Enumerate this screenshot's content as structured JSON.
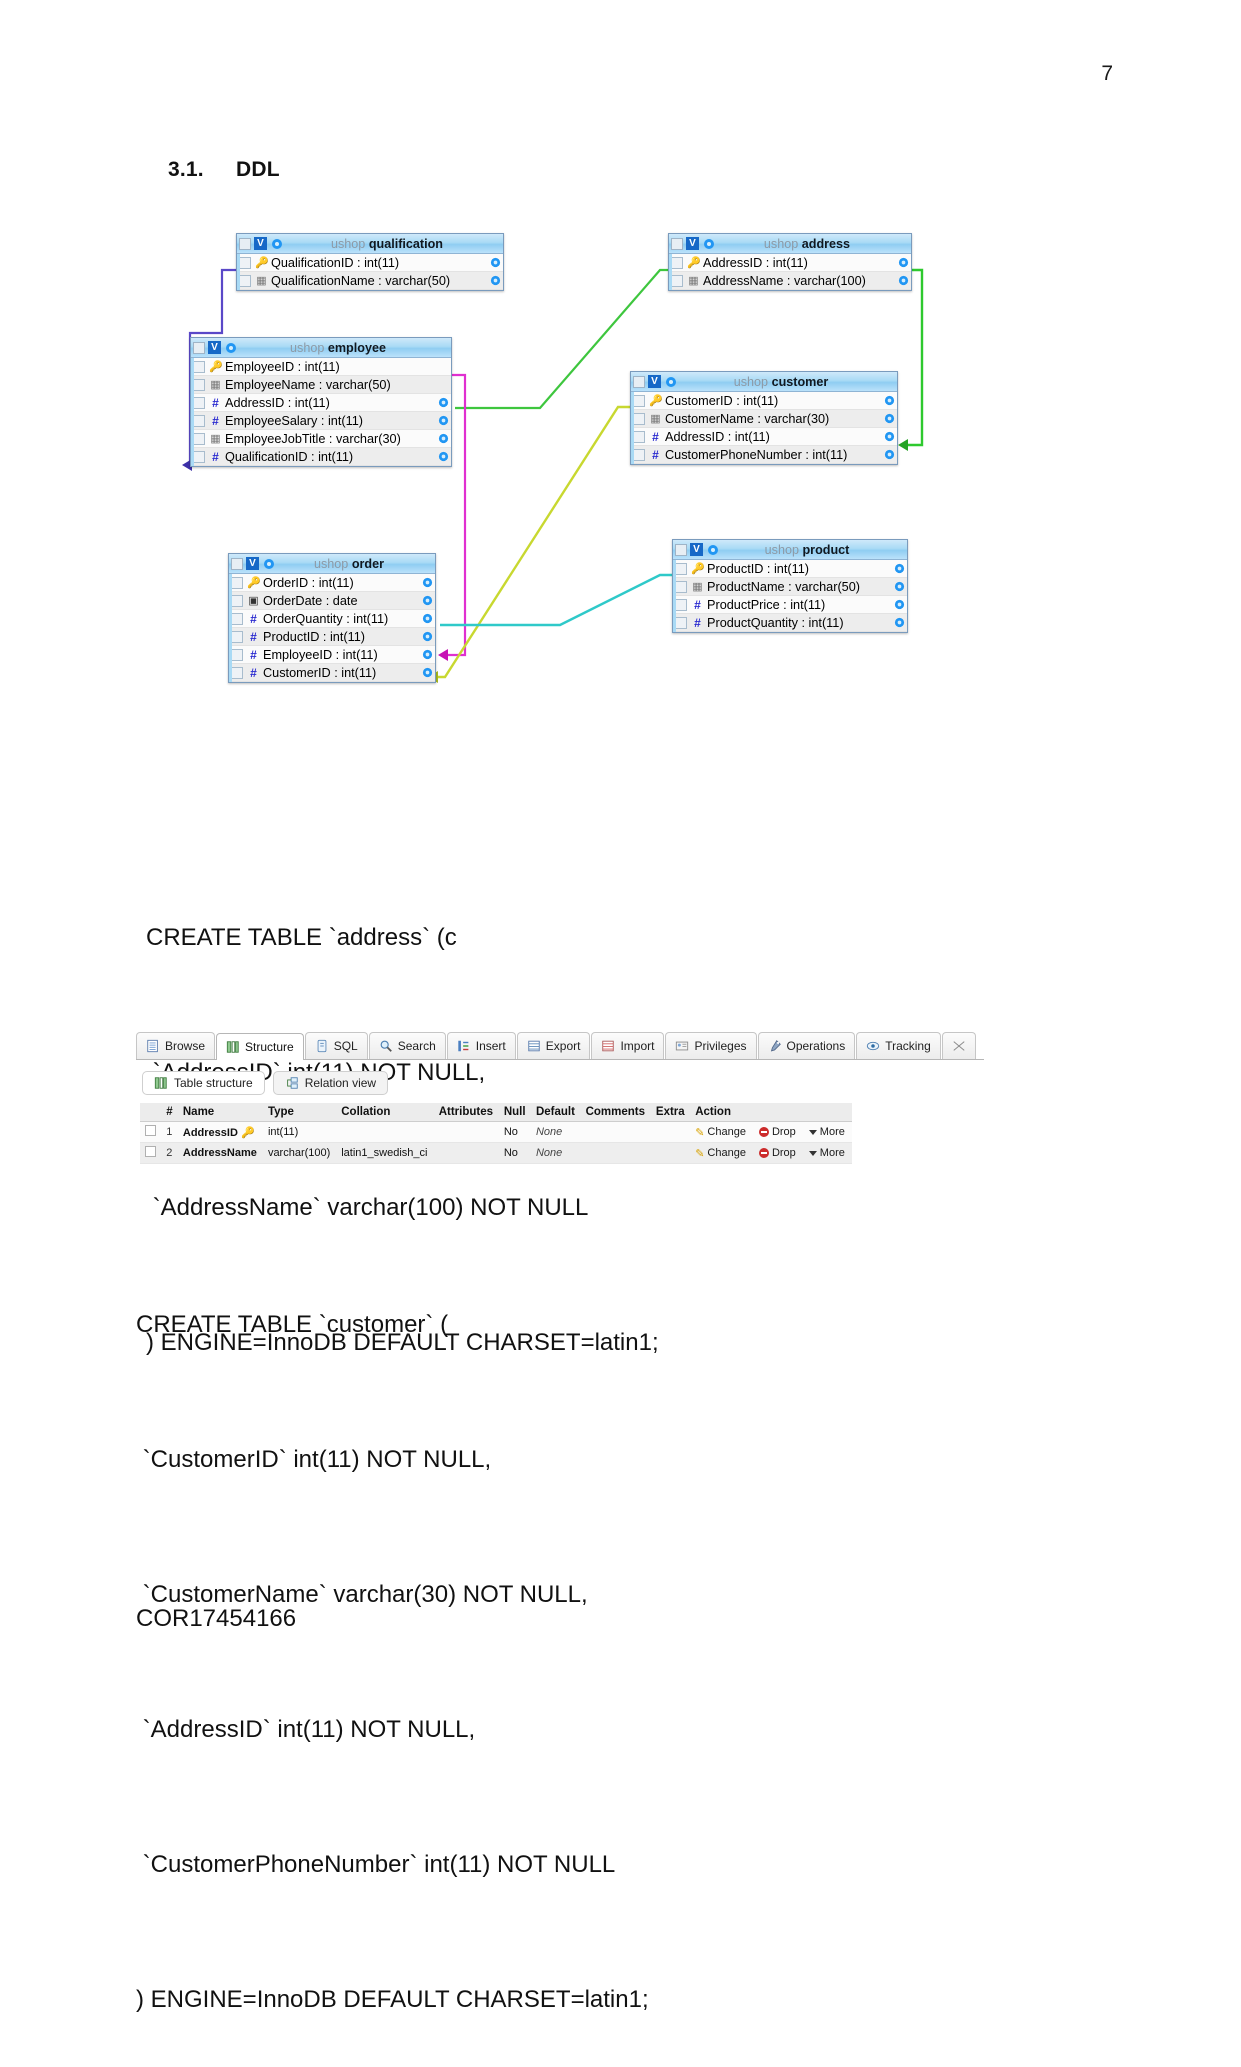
{
  "page": {
    "number": "7",
    "footer_id": "COR17454166"
  },
  "heading": {
    "number": "3.1.",
    "text": "DDL"
  },
  "designer": {
    "database": "ushop",
    "tables": [
      {
        "id": "qualification",
        "name": "qualification",
        "db": "ushop",
        "columns": [
          {
            "icon": "primary-key",
            "label": "QualificationID : int(11)"
          },
          {
            "icon": "text",
            "label": "QualificationName : varchar(50)"
          }
        ]
      },
      {
        "id": "address",
        "name": "address",
        "db": "ushop",
        "columns": [
          {
            "icon": "primary-key",
            "label": "AddressID : int(11)"
          },
          {
            "icon": "text",
            "label": "AddressName : varchar(100)"
          }
        ]
      },
      {
        "id": "employee",
        "name": "employee",
        "db": "ushop",
        "columns": [
          {
            "icon": "primary-key",
            "label": "EmployeeID : int(11)"
          },
          {
            "icon": "text",
            "label": "EmployeeName : varchar(50)"
          },
          {
            "icon": "number",
            "label": "AddressID : int(11)"
          },
          {
            "icon": "number",
            "label": "EmployeeSalary : int(11)"
          },
          {
            "icon": "text",
            "label": "EmployeeJobTitle : varchar(30)"
          },
          {
            "icon": "number",
            "label": "QualificationID : int(11)"
          }
        ]
      },
      {
        "id": "customer",
        "name": "customer",
        "db": "ushop",
        "columns": [
          {
            "icon": "primary-key",
            "label": "CustomerID : int(11)"
          },
          {
            "icon": "text",
            "label": "CustomerName : varchar(30)"
          },
          {
            "icon": "number",
            "label": "AddressID : int(11)"
          },
          {
            "icon": "number",
            "label": "CustomerPhoneNumber : int(11)"
          }
        ]
      },
      {
        "id": "order",
        "name": "order",
        "db": "ushop",
        "columns": [
          {
            "icon": "primary-key",
            "label": "OrderID : int(11)"
          },
          {
            "icon": "date",
            "label": "OrderDate : date"
          },
          {
            "icon": "number",
            "label": "OrderQuantity : int(11)"
          },
          {
            "icon": "number",
            "label": "ProductID : int(11)"
          },
          {
            "icon": "number",
            "label": "EmployeeID : int(11)"
          },
          {
            "icon": "number",
            "label": "CustomerID : int(11)"
          }
        ]
      },
      {
        "id": "product",
        "name": "product",
        "db": "ushop",
        "columns": [
          {
            "icon": "primary-key",
            "label": "ProductID : int(11)"
          },
          {
            "icon": "text",
            "label": "ProductName : varchar(50)"
          },
          {
            "icon": "number",
            "label": "ProductPrice : int(11)"
          },
          {
            "icon": "number",
            "label": "ProductQuantity : int(11)"
          }
        ]
      }
    ],
    "relation_colors": {
      "qualification_employee": "#5a48c8",
      "employee_address": "#2fbf2f",
      "customer_address": "#1fc31f",
      "employee_order": "#e02fd0",
      "customer_order": "#c8d830",
      "product_order": "#2fc9c9"
    }
  },
  "code_blocks": [
    {
      "id": "create-address",
      "lines": [
        "CREATE TABLE `address` (c",
        " `AddressID` int(11) NOT NULL,",
        " `AddressName` varchar(100) NOT NULL",
        ") ENGINE=InnoDB DEFAULT CHARSET=latin1;"
      ]
    },
    {
      "id": "create-customer",
      "lines": [
        "CREATE TABLE `customer` (",
        " `CustomerID` int(11) NOT NULL,",
        " `CustomerName` varchar(30) NOT NULL,",
        " `AddressID` int(11) NOT NULL,",
        " `CustomerPhoneNumber` int(11) NOT NULL",
        ") ENGINE=InnoDB DEFAULT CHARSET=latin1;"
      ]
    }
  ],
  "phpmyadmin": {
    "tabs": [
      {
        "label": "Browse",
        "icon": "browse-icon",
        "active": false
      },
      {
        "label": "Structure",
        "icon": "structure-icon",
        "active": true
      },
      {
        "label": "SQL",
        "icon": "sql-icon",
        "active": false
      },
      {
        "label": "Search",
        "icon": "search-icon",
        "active": false
      },
      {
        "label": "Insert",
        "icon": "insert-icon",
        "active": false
      },
      {
        "label": "Export",
        "icon": "export-icon",
        "active": false
      },
      {
        "label": "Import",
        "icon": "import-icon",
        "active": false
      },
      {
        "label": "Privileges",
        "icon": "privileges-icon",
        "active": false
      },
      {
        "label": "Operations",
        "icon": "operations-icon",
        "active": false
      },
      {
        "label": "Tracking",
        "icon": "tracking-icon",
        "active": false
      }
    ],
    "subtabs": [
      {
        "label": "Table structure",
        "icon": "structure-icon",
        "active": true
      },
      {
        "label": "Relation view",
        "icon": "relation-icon",
        "active": false
      }
    ],
    "columns": [
      "#",
      "Name",
      "Type",
      "Collation",
      "Attributes",
      "Null",
      "Default",
      "Comments",
      "Extra",
      "Action"
    ],
    "rows": [
      {
        "num": "1",
        "name": "AddressID",
        "primary": true,
        "type": "int(11)",
        "collation": "",
        "attributes": "",
        "null": "No",
        "default": "None",
        "comments": "",
        "extra": "",
        "actions": [
          "Change",
          "Drop",
          "More"
        ]
      },
      {
        "num": "2",
        "name": "AddressName",
        "primary": false,
        "type": "varchar(100)",
        "collation": "latin1_swedish_ci",
        "attributes": "",
        "null": "No",
        "default": "None",
        "comments": "",
        "extra": "",
        "actions": [
          "Change",
          "Drop",
          "More"
        ]
      }
    ]
  }
}
